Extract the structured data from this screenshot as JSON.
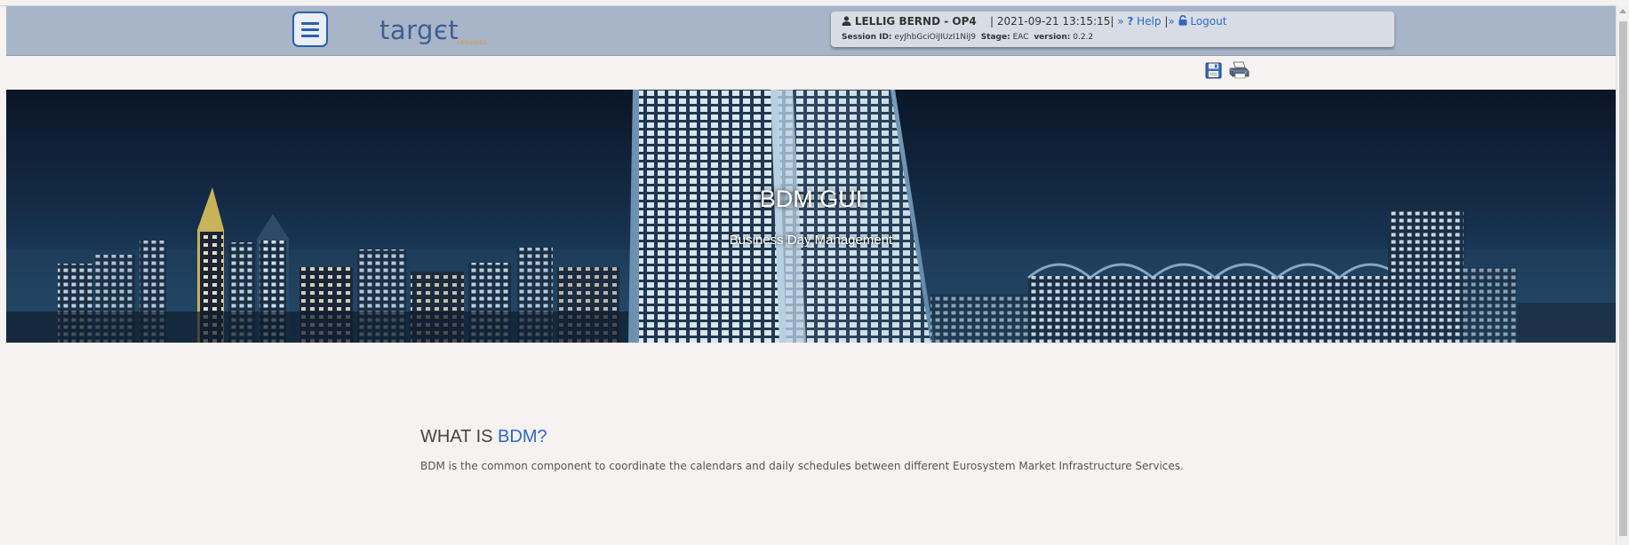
{
  "header": {
    "logo_text": "targєt",
    "logo_sub": "SERVICES"
  },
  "session": {
    "user": "LELLIG BERND - OP4",
    "datetime": "2021-09-21 13:15:15",
    "help_label": "Help",
    "logout_label": "Logout",
    "session_id_label": "Session ID:",
    "session_id_value": "eyJhbGciOiJIUzI1NiJ9",
    "stage_label": "Stage:",
    "stage_value": "EAC",
    "version_label": "version:",
    "version_value": "0.2.2"
  },
  "hero": {
    "title": "BDM GUI",
    "subtitle": "Business Day Management"
  },
  "section": {
    "title_prefix": "WHAT IS ",
    "title_accent": "BDM?",
    "text": "BDM is the common component to coordinate the calendars and daily schedules between different Eurosystem Market Infrastructure Services."
  },
  "colors": {
    "header_bg": "#a8b4c8",
    "accent": "#2f69c2",
    "page_bg": "#f6f2f2"
  },
  "icons": {
    "menu": "hamburger-menu-icon",
    "user": "user-icon",
    "help": "question-mark-icon",
    "logout": "lock-icon",
    "save": "floppy-disk-icon",
    "print": "printer-icon"
  }
}
